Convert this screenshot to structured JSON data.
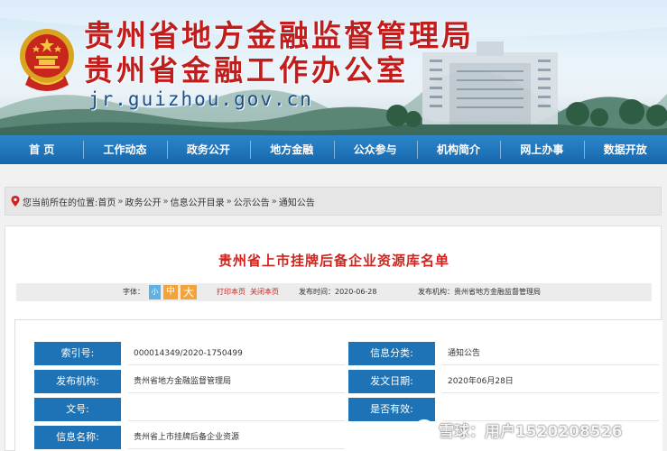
{
  "header": {
    "title": "贵州省地方金融监督管理局",
    "subtitle": "贵州省金融工作办公室",
    "domain": "jr.guizhou.gov.cn"
  },
  "nav": {
    "items": [
      "首 页",
      "工作动态",
      "政务公开",
      "地方金融",
      "公众参与",
      "机构简介",
      "网上办事",
      "数据开放"
    ]
  },
  "breadcrumb": {
    "prefix": "您当前所在的位置:",
    "items": [
      "首页",
      "政务公开",
      "信息公开目录",
      "公示公告",
      "通知公告"
    ],
    "separator": "»"
  },
  "article": {
    "title": "贵州省上市挂牌后备企业资源库名单",
    "font_label": "字体：",
    "font_sizes": [
      "小",
      "中",
      "大"
    ],
    "print_label": "打印本页",
    "close_label": "关闭本页",
    "pubdate_text": "发布时间：2020-06-28",
    "issuer_text": "发布机构：贵州省地方金融监督管理局"
  },
  "info_table": {
    "rows": [
      {
        "label": "索引号:",
        "value": "000014349/2020-1750499",
        "label2": "信息分类:",
        "value2": "通知公告"
      },
      {
        "label": "发布机构:",
        "value": "贵州省地方金融监督管理局",
        "label2": "发文日期:",
        "value2": "2020年06月28日"
      },
      {
        "label": "文号:",
        "value": "",
        "label2": "是否有效:",
        "value2": ""
      },
      {
        "label": "信息名称:",
        "value": "贵州省上市挂牌后备企业资源",
        "label2": "",
        "value2": ""
      }
    ]
  },
  "watermark": {
    "text": "雪球：用户1520208526"
  },
  "colors": {
    "nav_blue": "#1767ad",
    "label_blue": "#1d73b5",
    "title_red": "#d1241e",
    "banner_red": "#c21d1d"
  }
}
